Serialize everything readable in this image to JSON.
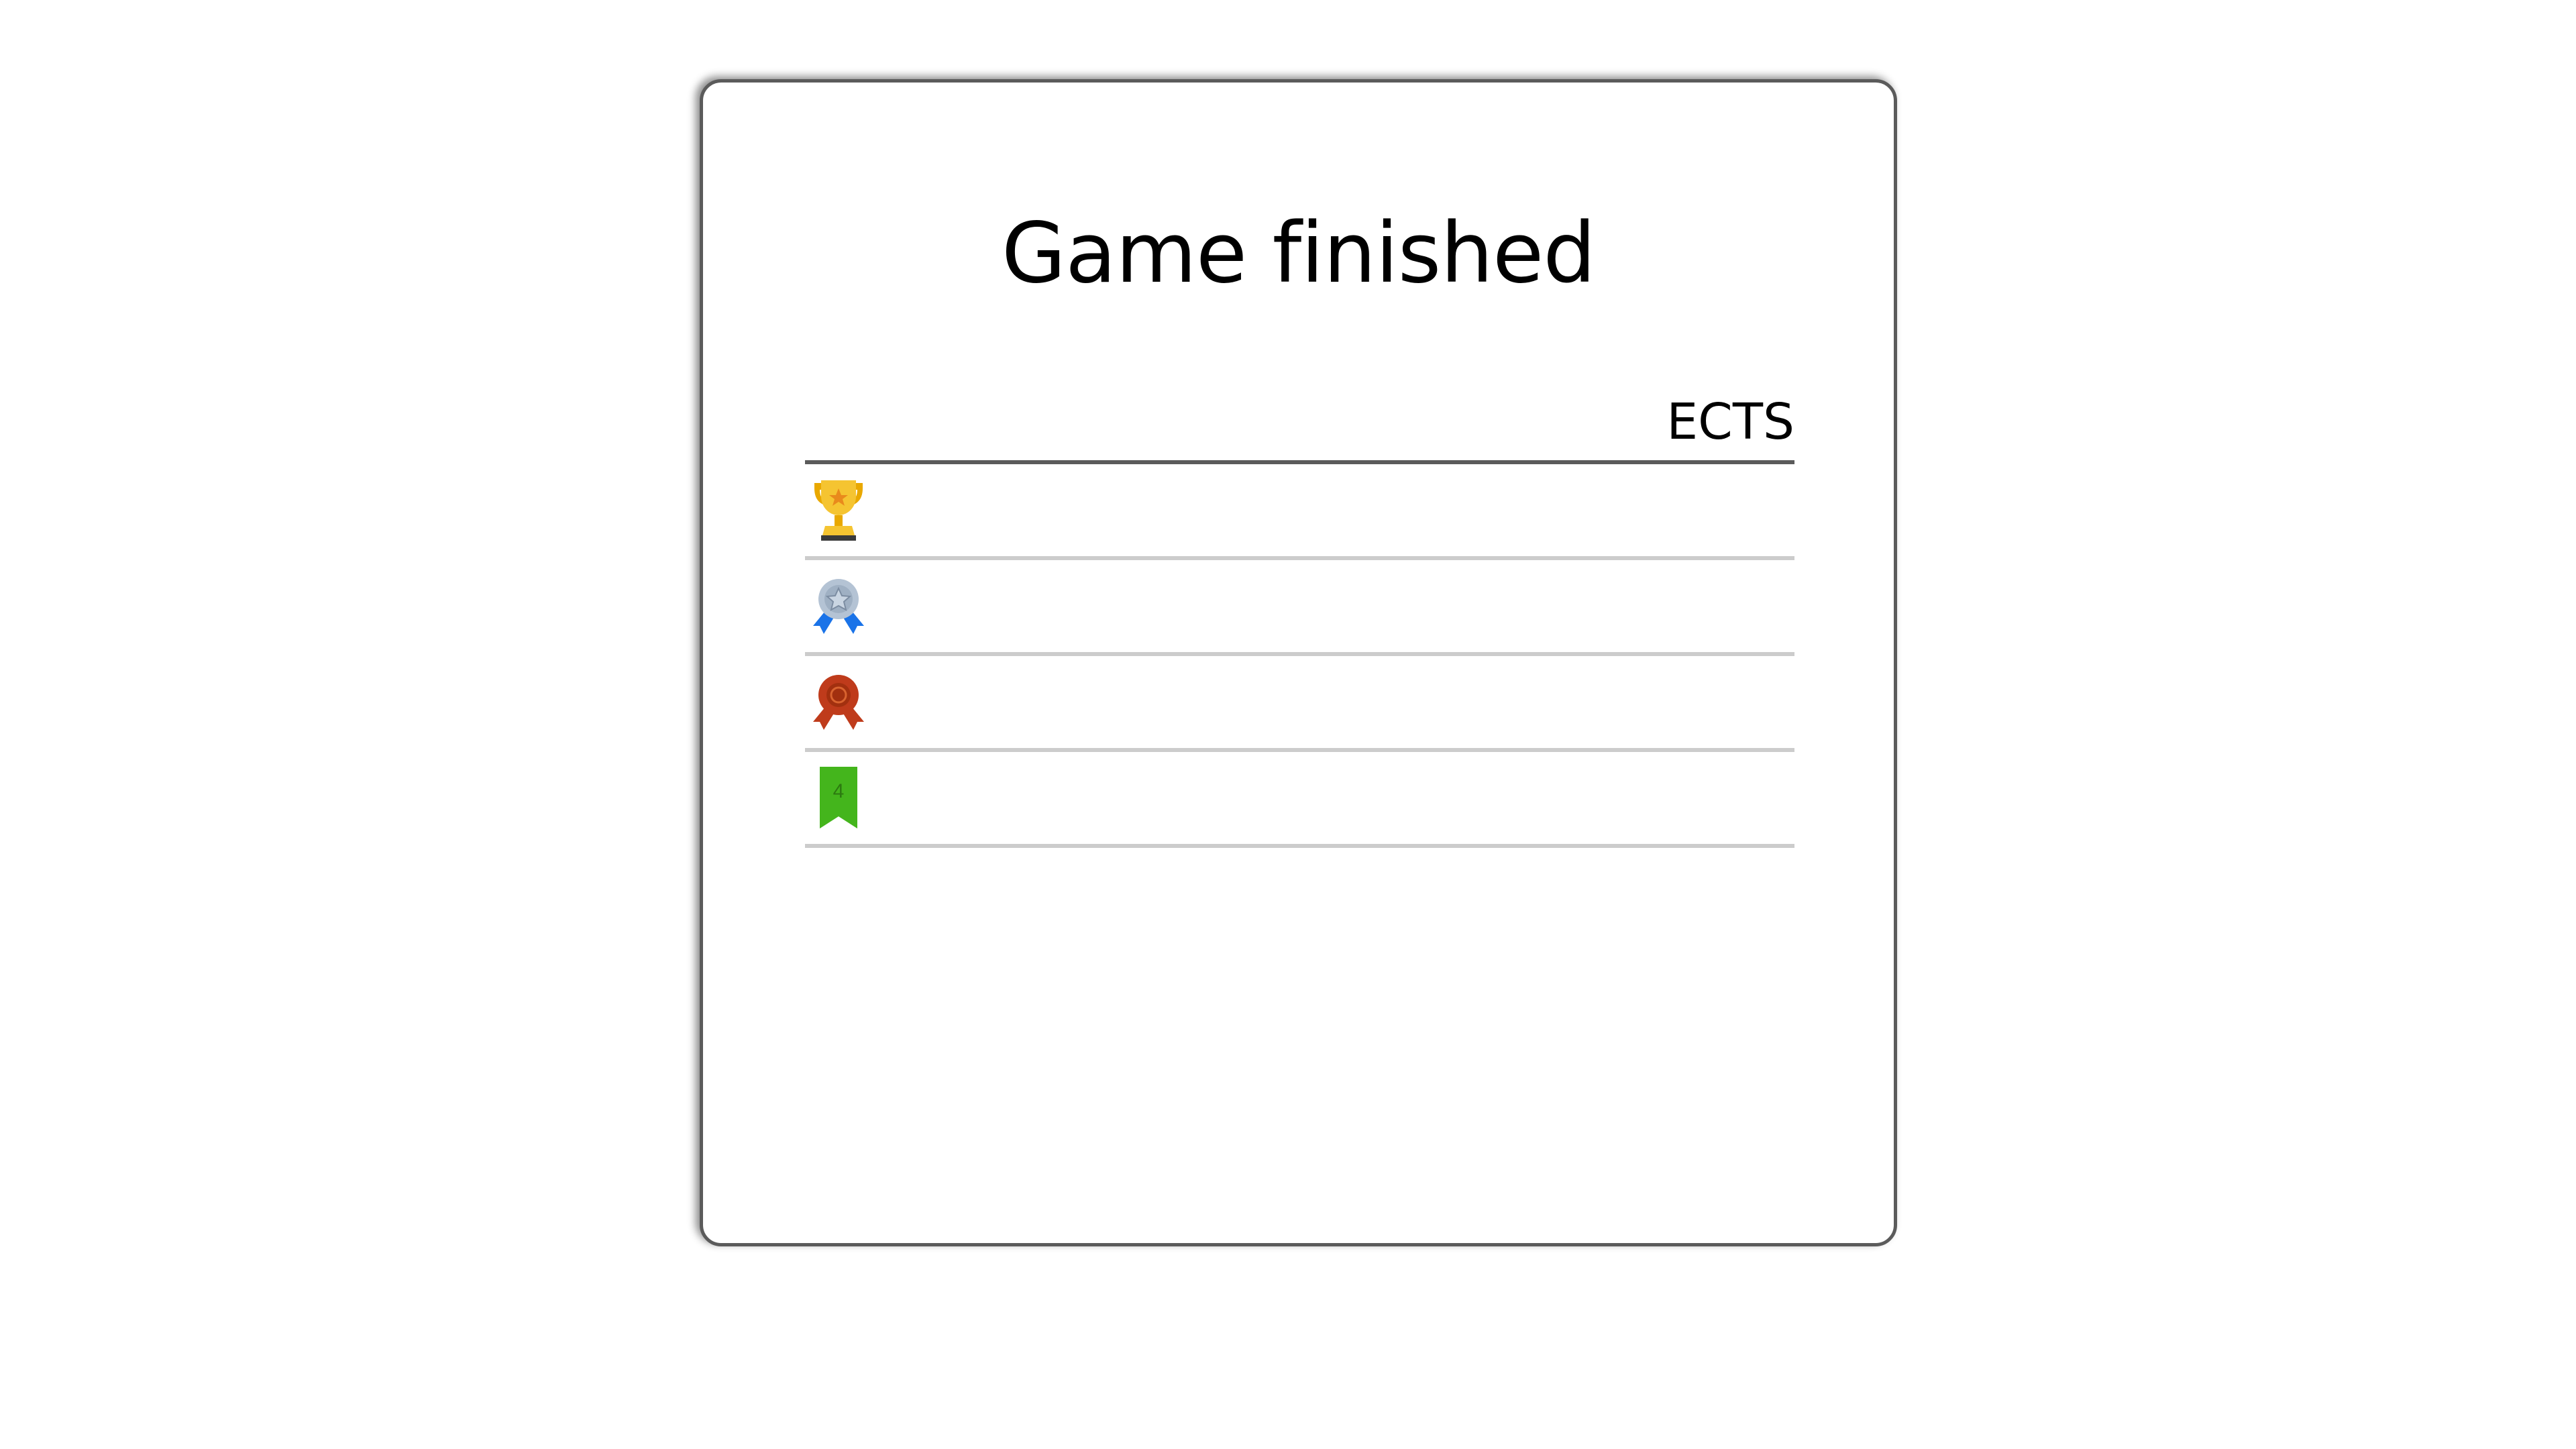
{
  "dialog": {
    "title": "Game finished",
    "columns": {
      "ects": "ECTS"
    },
    "rows": [
      {
        "rank": 1,
        "icon": "gold-trophy-icon",
        "ects": ""
      },
      {
        "rank": 2,
        "icon": "silver-medal-icon",
        "ects": ""
      },
      {
        "rank": 3,
        "icon": "bronze-medal-icon",
        "ects": ""
      },
      {
        "rank": 4,
        "icon": "green-ribbon-icon",
        "label": "4",
        "ects": ""
      }
    ]
  },
  "colors": {
    "card_border": "#5b5b5b",
    "row_divider": "#cccccc",
    "gold": "#f5c431",
    "silver": "#b4c3d4",
    "blue_ribbon": "#1a73e8",
    "bronze": "#bf3b1b",
    "green": "#44b51c"
  }
}
